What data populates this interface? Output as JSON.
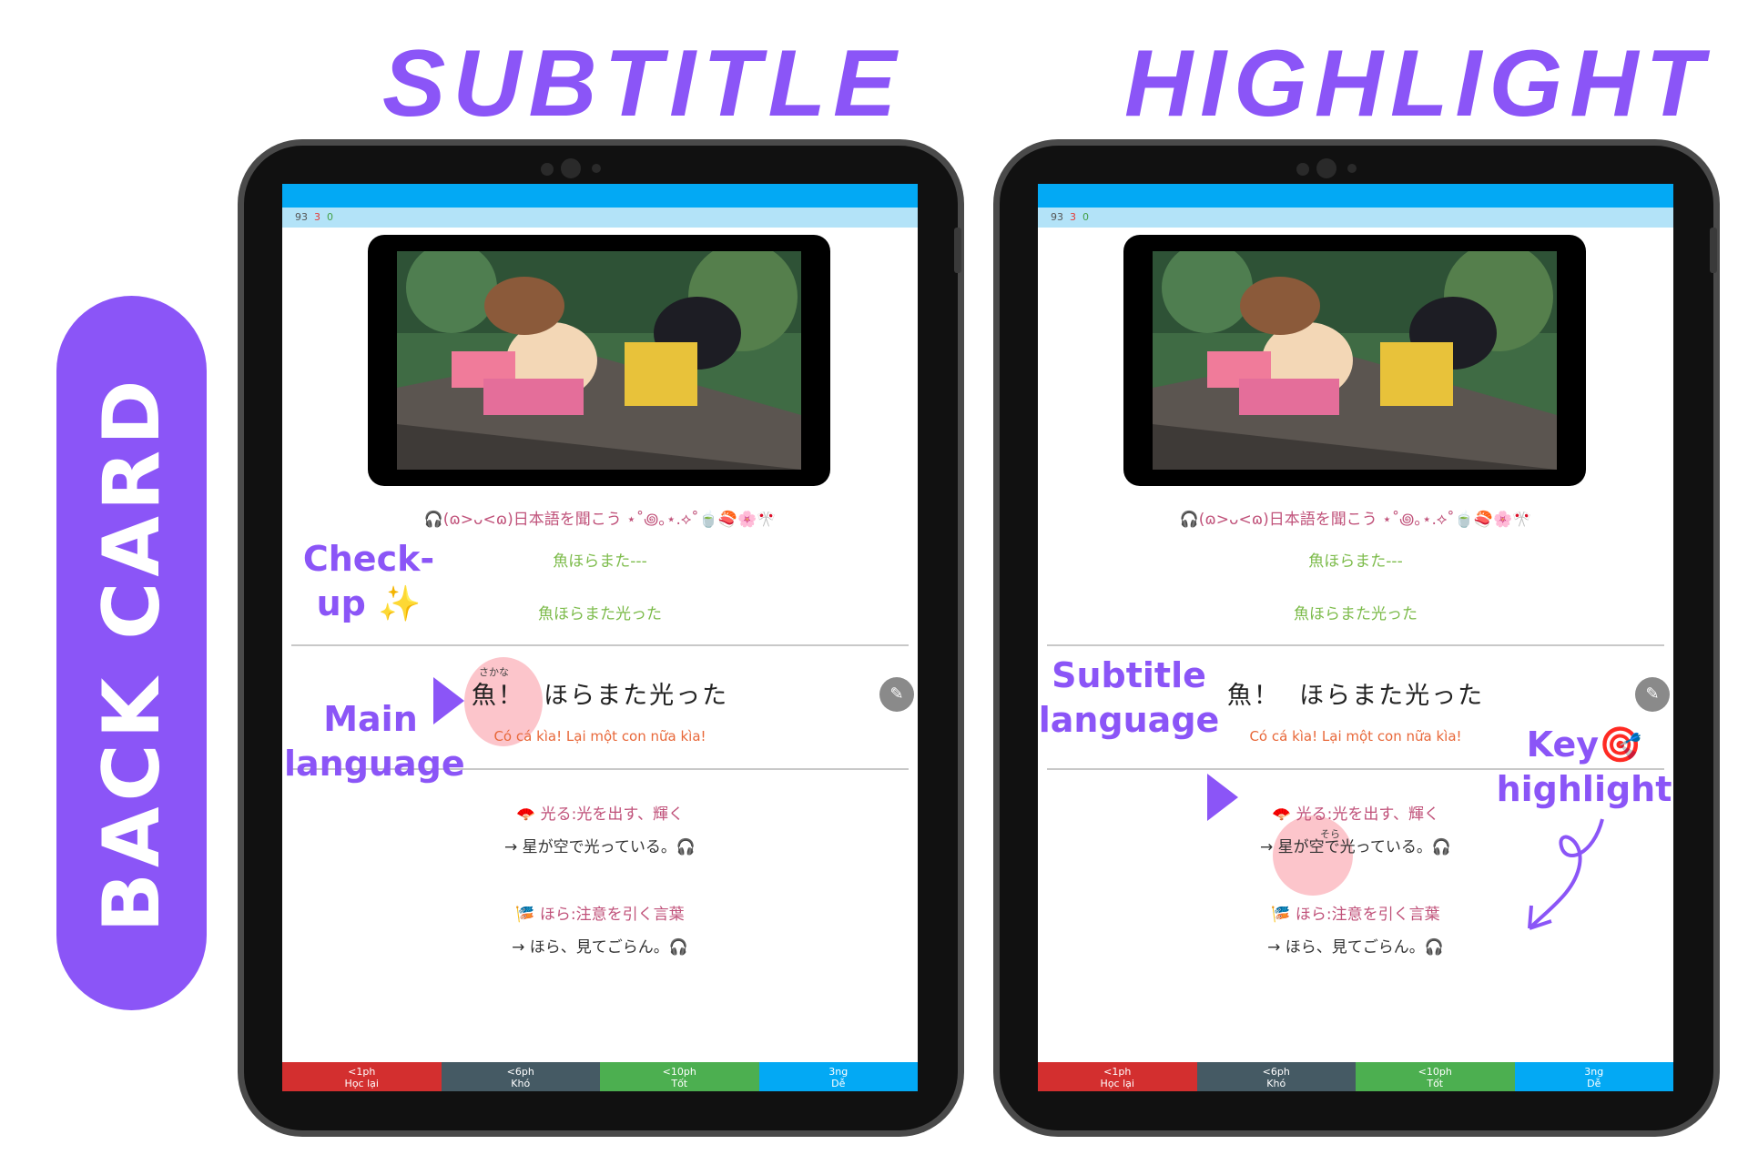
{
  "titles": {
    "left": "SUBTITLE",
    "right": "HIGHLIGHT"
  },
  "side_label": "BACK CARD",
  "card": {
    "stats": {
      "new": "93",
      "learning": "3",
      "review": "0"
    },
    "deco_line": "🎧(ɷ>ᴗ<ɷ)日本語を聞こう ⋆˚꩜｡⋆.⟡˚🍵🍣🌸🎌",
    "checkup_line1": "魚ほらまた---",
    "checkup_line2": "魚ほらまた光った",
    "main_word": "魚！",
    "main_rest": "ほらまた光った",
    "furigana": "さかな",
    "translation": "Có cá kìa! Lại một con nữa kìa!",
    "def1": "🪭 光る:光を出す、輝く",
    "ex1": "→ 星が空で光っている。🎧",
    "def1_ruby": "そら",
    "def2": "🎏 ほら:注意を引く言葉",
    "ex2": "→ ほら、見てごらん。🎧",
    "edit_icon": "pencil-icon",
    "buttons": [
      {
        "time": "<1ph",
        "label": "Học lại",
        "color": "#d32f2f"
      },
      {
        "time": "<6ph",
        "label": "Khó",
        "color": "#455a64"
      },
      {
        "time": "<10ph",
        "label": "Tốt",
        "color": "#4caf50"
      },
      {
        "time": "3ng",
        "label": "Dễ",
        "color": "#03a9f4"
      }
    ]
  },
  "annotations": {
    "checkup": "Check-\nup ✨",
    "main_language": "Main\nlanguage",
    "subtitle_language": "Subtitle\nlanguage",
    "key_highlight": "Key🎯\nhighlight"
  },
  "colors": {
    "accent": "#8b55f7",
    "highlight": "#f9a0a8"
  }
}
